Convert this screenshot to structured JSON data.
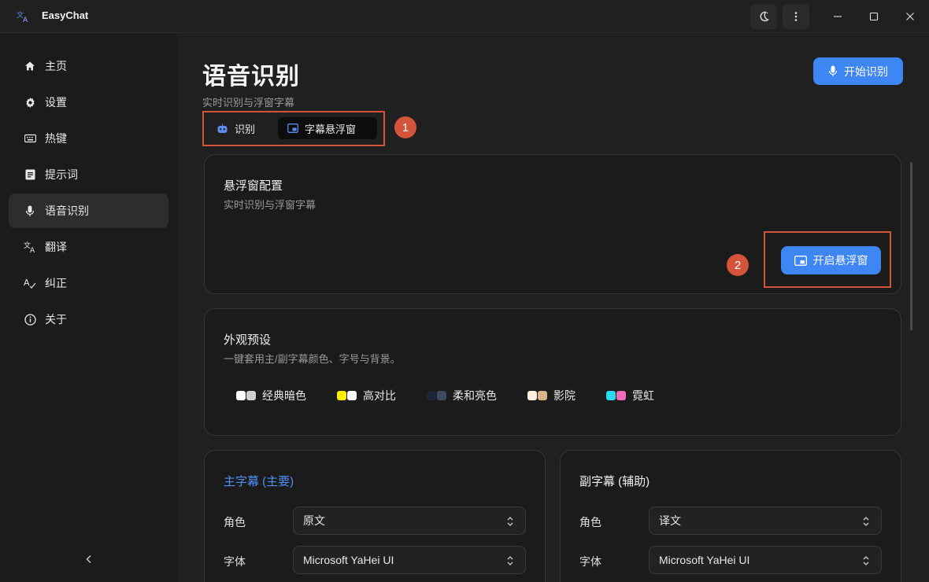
{
  "app": {
    "title": "EasyChat",
    "logo_icon": "translate-icon"
  },
  "titlebar": {
    "theme_icon": "moon-icon",
    "more_icon": "more-vertical-icon",
    "minimize_icon": "minimize-icon",
    "maximize_icon": "maximize-icon",
    "close_icon": "close-icon"
  },
  "sidebar": {
    "items": [
      {
        "label": "主页",
        "icon": "home-icon"
      },
      {
        "label": "设置",
        "icon": "gear-icon"
      },
      {
        "label": "热键",
        "icon": "keyboard-icon"
      },
      {
        "label": "提示词",
        "icon": "document-icon"
      },
      {
        "label": "语音识别",
        "icon": "microphone-icon",
        "active": true
      },
      {
        "label": "翻译",
        "icon": "translate-icon"
      },
      {
        "label": "纠正",
        "icon": "spellcheck-icon"
      },
      {
        "label": "关于",
        "icon": "info-icon"
      }
    ],
    "collapse_icon": "chevron-left-icon"
  },
  "header": {
    "title": "语音识别",
    "subtitle": "实时识别与浮窗字幕",
    "start_button": "开始识别"
  },
  "tabs": [
    {
      "label": "识别",
      "icon": "robot-icon"
    },
    {
      "label": "字幕悬浮窗",
      "icon": "picture-in-picture-icon",
      "selected": true
    }
  ],
  "badges": {
    "step1": "1",
    "step2": "2"
  },
  "floating_config": {
    "title": "悬浮窗配置",
    "desc": "实时识别与浮窗字幕",
    "open_button": "开启悬浮窗"
  },
  "appearance": {
    "title": "外观预设",
    "desc": "一键套用主/副字幕颜色、字号与背景。",
    "presets": [
      {
        "label": "经典暗色",
        "colors": [
          "#ffffff",
          "#cfcfcf"
        ]
      },
      {
        "label": "高对比",
        "colors": [
          "#ffee00",
          "#ffffff"
        ]
      },
      {
        "label": "柔和亮色",
        "colors": [
          "#1e2536",
          "#3d4a63"
        ]
      },
      {
        "label": "影院",
        "colors": [
          "#fff3e0",
          "#d9b48a"
        ]
      },
      {
        "label": "霓虹",
        "colors": [
          "#2bd9f0",
          "#f06cb8"
        ]
      }
    ]
  },
  "primary_subtitle": {
    "title": "主字幕 (主要)",
    "role_label": "角色",
    "role_value": "原文",
    "font_label": "字体",
    "font_value": "Microsoft YaHei UI"
  },
  "secondary_subtitle": {
    "title": "副字幕 (辅助)",
    "role_label": "角色",
    "role_value": "译文",
    "font_label": "字体",
    "font_value": "Microsoft YaHei UI"
  },
  "colors": {
    "accent": "#3f86f5",
    "annotation": "#d4533b"
  }
}
